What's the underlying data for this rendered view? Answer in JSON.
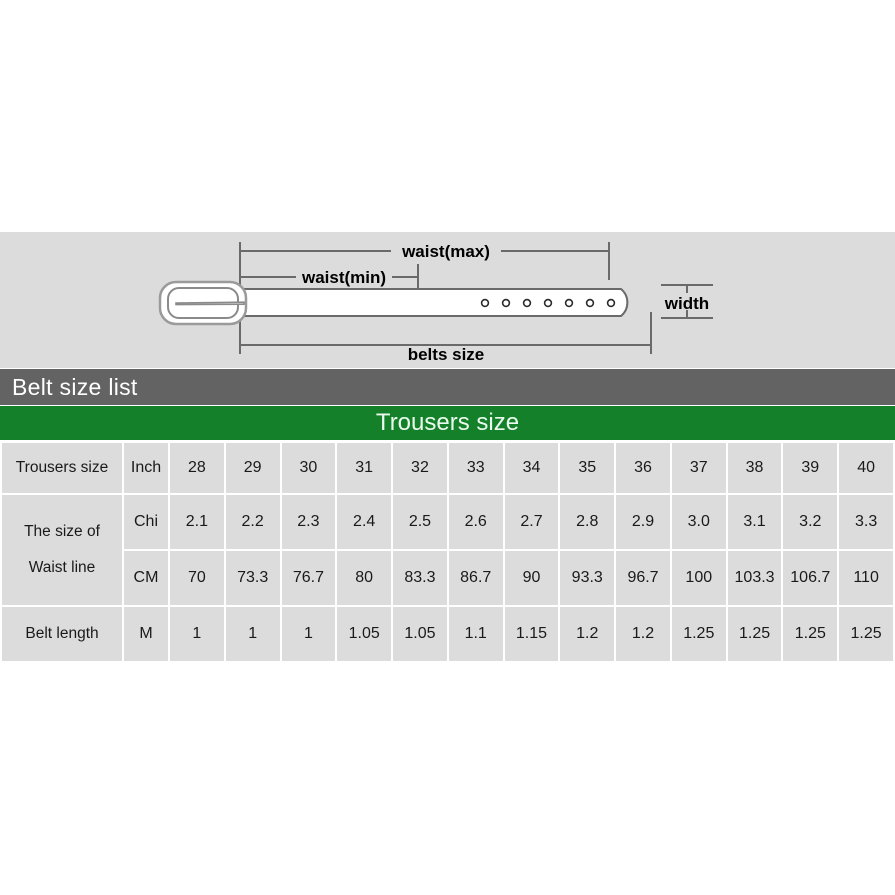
{
  "diagram": {
    "labels": {
      "waist_max": "waist(max)",
      "waist_min": "waist(min)",
      "belts_size": "belts size",
      "width": "width"
    },
    "hole_count": 7,
    "colors": {
      "panel_bg": "#dcdcdc",
      "belt_fill": "#ffffff",
      "line": "#6a6a6a",
      "text": "#000000"
    }
  },
  "title_bar": {
    "text": "Belt size  list",
    "bg": "#636363",
    "fg": "#ffffff"
  },
  "green_band": {
    "text": "Trousers size",
    "bg": "#14802a",
    "fg": "#eafaee"
  },
  "table": {
    "cell_bg": "#dcdcdc",
    "rows": [
      {
        "label": "Trousers size",
        "label_rowspan": 1,
        "unit": "Inch",
        "values": [
          "28",
          "29",
          "30",
          "31",
          "32",
          "33",
          "34",
          "35",
          "36",
          "37",
          "38",
          "39",
          "40"
        ]
      },
      {
        "label": "The size of",
        "label2": "Waist line",
        "label_rowspan": 2,
        "unit": "Chi",
        "values": [
          "2.1",
          "2.2",
          "2.3",
          "2.4",
          "2.5",
          "2.6",
          "2.7",
          "2.8",
          "2.9",
          "3.0",
          "3.1",
          "3.2",
          "3.3"
        ]
      },
      {
        "label": "",
        "label_rowspan": 0,
        "unit": "CM",
        "values": [
          "70",
          "73.3",
          "76.7",
          "80",
          "83.3",
          "86.7",
          "90",
          "93.3",
          "96.7",
          "100",
          "103.3",
          "106.7",
          "110"
        ]
      },
      {
        "label": "Belt length",
        "label_rowspan": 1,
        "unit": "M",
        "values": [
          "1",
          "1",
          "1",
          "1.05",
          "1.05",
          "1.1",
          "1.15",
          "1.2",
          "1.2",
          "1.25",
          "1.25",
          "1.25",
          "1.25"
        ]
      }
    ]
  }
}
